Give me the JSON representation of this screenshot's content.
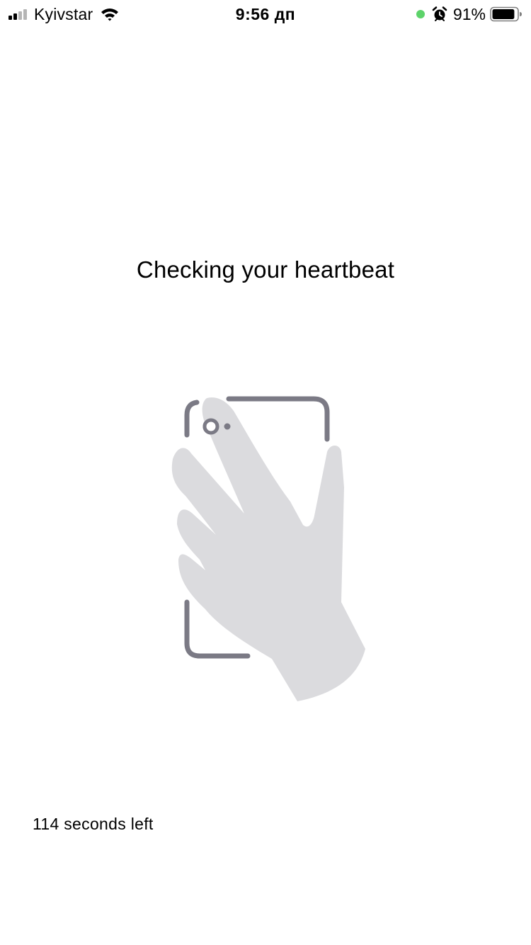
{
  "status_bar": {
    "carrier": "Kyivstar",
    "time": "9:56 дп",
    "battery_percent": "91%",
    "battery_level": 0.91,
    "signal_bars_filled": 2,
    "signal_bars_total": 4,
    "icons": [
      "signal-icon",
      "wifi-icon",
      "mic-indicator-icon",
      "alarm-icon",
      "battery-icon"
    ],
    "indicator_color": "#5dd36a"
  },
  "main": {
    "title": "Checking your heartbeat",
    "countdown": "114 seconds left",
    "illustration": "hand-on-phone-camera-icon"
  },
  "colors": {
    "frame": "#7b7a85",
    "hand": "#d9d9dc",
    "background": "#ffffff"
  }
}
